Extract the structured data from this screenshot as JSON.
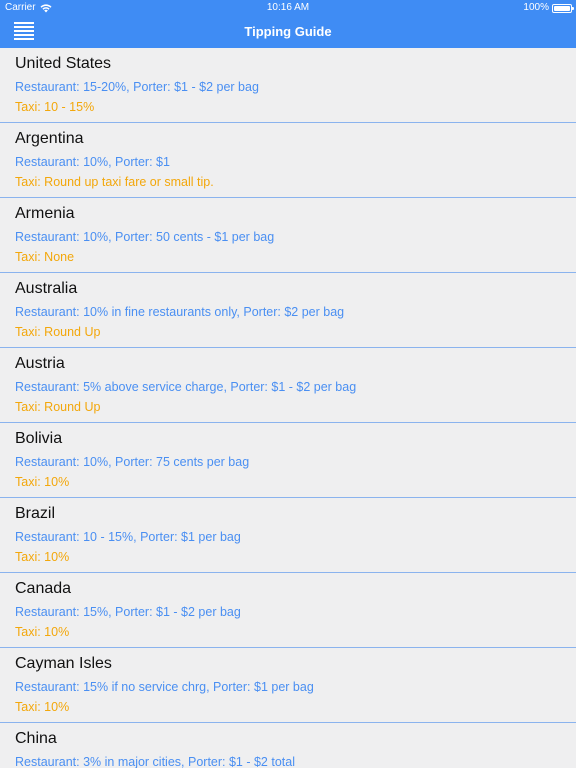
{
  "status_bar": {
    "carrier": "Carrier",
    "time": "10:16 AM",
    "battery": "100%"
  },
  "nav": {
    "title": "Tipping Guide",
    "menu_icon": "hamburger-menu-icon"
  },
  "colors": {
    "header": "#3f8cf4",
    "detail_text": "#4a8ff2",
    "taxi_text": "#f3a70b",
    "background": "#efeff0"
  },
  "countries": [
    {
      "name": "United States",
      "detail": "Restaurant: 15-20%,  Porter:  $1 - $2 per bag",
      "taxi": "Taxi:  10 - 15%"
    },
    {
      "name": "Argentina",
      "detail": "Restaurant: 10%,  Porter:  $1",
      "taxi": "Taxi:  Round up taxi fare or small tip."
    },
    {
      "name": "Armenia",
      "detail": "Restaurant: 10%,  Porter:  50 cents - $1 per bag",
      "taxi": "Taxi:  None"
    },
    {
      "name": "Australia",
      "detail": "Restaurant: 10% in fine restaurants only,  Porter:  $2 per bag",
      "taxi": "Taxi:  Round Up"
    },
    {
      "name": "Austria",
      "detail": "Restaurant: 5% above service charge,  Porter:  $1 - $2 per bag",
      "taxi": "Taxi:  Round Up"
    },
    {
      "name": "Bolivia",
      "detail": "Restaurant: 10%,  Porter:  75 cents per bag",
      "taxi": "Taxi:  10%"
    },
    {
      "name": "Brazil",
      "detail": "Restaurant: 10 - 15%,  Porter:  $1 per bag",
      "taxi": "Taxi:  10%"
    },
    {
      "name": "Canada",
      "detail": "Restaurant: 15%,  Porter:  $1 - $2 per bag",
      "taxi": "Taxi:  10%"
    },
    {
      "name": "Cayman Isles",
      "detail": "Restaurant: 15% if no service chrg,  Porter:  $1 per bag",
      "taxi": "Taxi:  10%"
    },
    {
      "name": "China",
      "detail": "Restaurant: 3% in major cities,  Porter:  $1 - $2 total",
      "taxi": ""
    }
  ]
}
